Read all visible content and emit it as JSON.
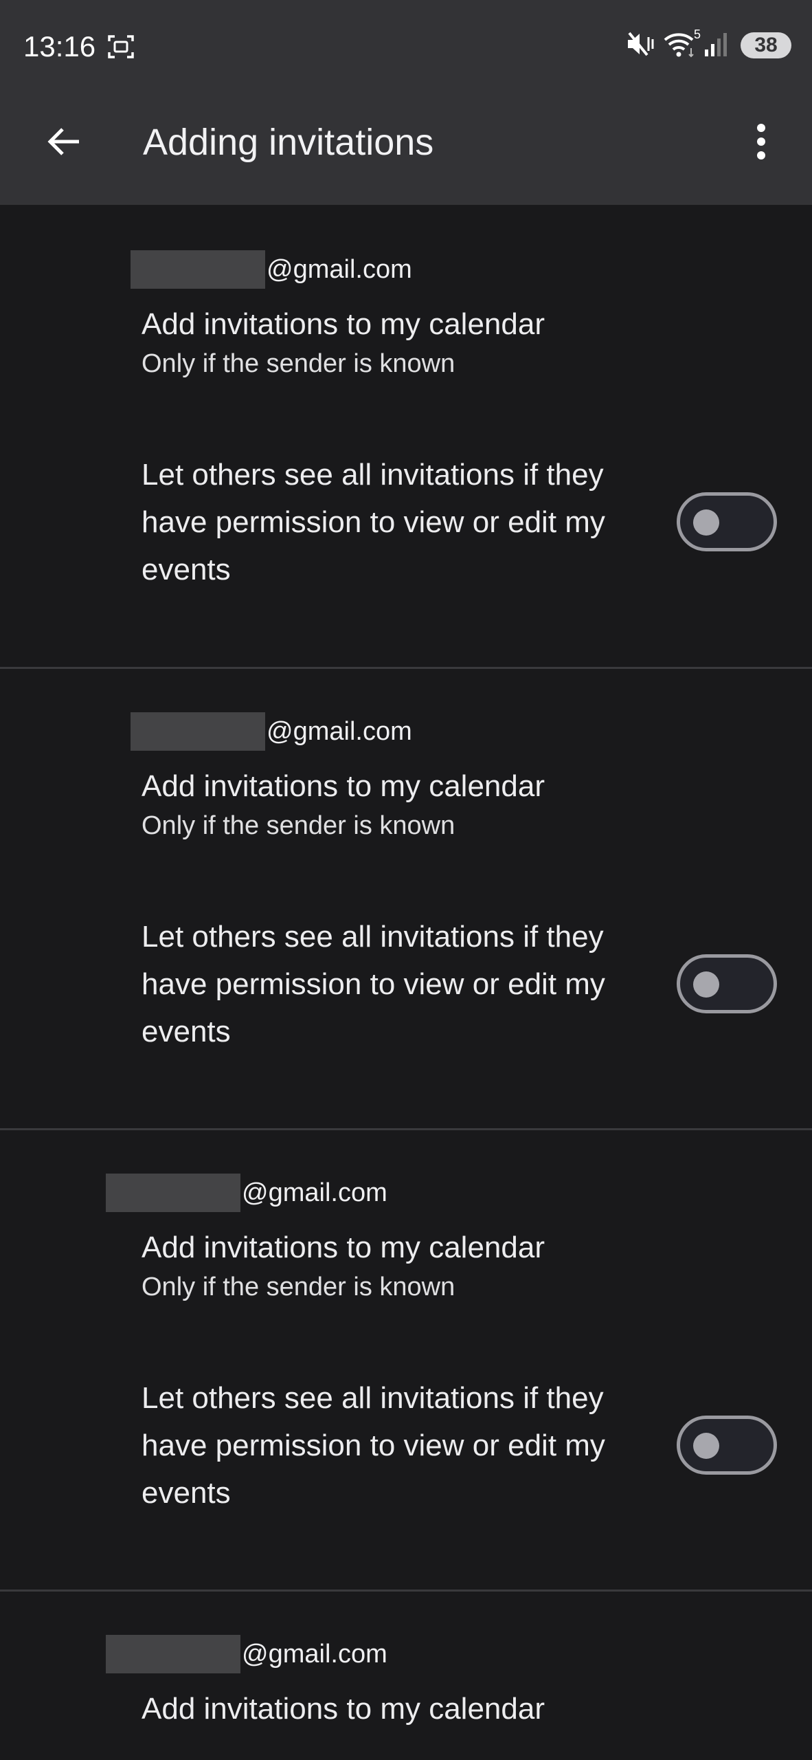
{
  "status_bar": {
    "time": "13:16",
    "screenshot_icon": "screenshot-icon",
    "mute_icon": "vibrate-mute-icon",
    "wifi_icon": "wifi-icon",
    "wifi_label": "5",
    "signal_icon": "signal-bars-icon",
    "battery": "38"
  },
  "app_bar": {
    "back_icon": "arrow-back-icon",
    "title": "Adding invitations",
    "more_icon": "more-vert-icon"
  },
  "accounts": [
    {
      "email_suffix": "@gmail.com",
      "add_title": "Add invitations to my calendar",
      "add_subtitle": "Only if the sender is known",
      "share_label": "Let others see all invitations if they have permission to view or edit my events",
      "share_enabled": false
    },
    {
      "email_suffix": "@gmail.com",
      "add_title": "Add invitations to my calendar",
      "add_subtitle": "Only if the sender is known",
      "share_label": "Let others see all invitations if they have permission to view or edit my events",
      "share_enabled": false
    },
    {
      "email_suffix": "@gmail.com",
      "add_title": "Add invitations to my calendar",
      "add_subtitle": "Only if the sender is known",
      "share_label": "Let others see all invitations if they have permission to view or edit my events",
      "share_enabled": false
    },
    {
      "email_suffix": "@gmail.com",
      "add_title": "Add invitations to my calendar"
    }
  ]
}
